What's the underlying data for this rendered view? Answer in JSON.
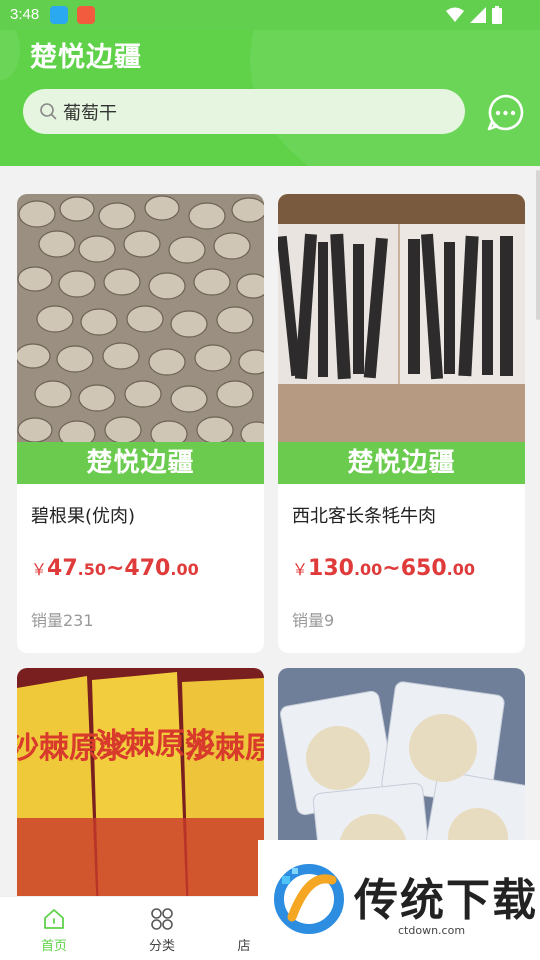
{
  "status": {
    "time": "3:48"
  },
  "header": {
    "title": "楚悦边疆"
  },
  "search": {
    "value": "葡萄干"
  },
  "products": [
    {
      "banner": "楚悦边疆",
      "name": "碧根果(优肉)",
      "currency": "￥",
      "price_low_int": "47",
      "price_low_dec": ".50",
      "sep": "~",
      "price_high_int": "470",
      "price_high_dec": ".00",
      "sales": "销量231"
    },
    {
      "banner": "楚悦边疆",
      "name": "西北客长条牦牛肉",
      "currency": "￥",
      "price_low_int": "130",
      "price_low_dec": ".00",
      "sep": "~",
      "price_high_int": "650",
      "price_high_dec": ".00",
      "sales": "销量9"
    },
    {
      "img_text": "沙棘原浆"
    },
    {}
  ],
  "nav": [
    {
      "label": "首页",
      "icon": "home-icon",
      "active": true
    },
    {
      "label": "分类",
      "icon": "category-icon"
    },
    {
      "label": "店"
    }
  ],
  "watermark": {
    "text": "传统下载",
    "url": "ctdown.com"
  },
  "colors": {
    "brand_green": "#5fd24a",
    "price_red": "#e03b3b"
  }
}
